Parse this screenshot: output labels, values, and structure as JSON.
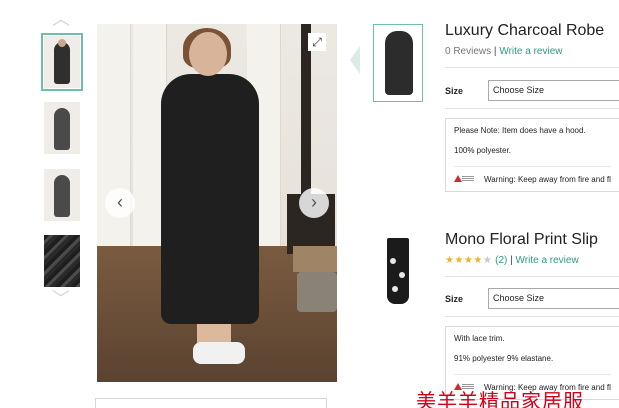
{
  "gallery": {
    "thumbnails": [
      {
        "kind": "model-full",
        "active": true
      },
      {
        "kind": "robe-front",
        "active": false
      },
      {
        "kind": "robe-back",
        "active": false
      },
      {
        "kind": "fabric-closeup",
        "active": false
      }
    ],
    "up_icon": "chevron-up-icon",
    "down_icon": "chevron-down-icon",
    "expand_icon": "expand-icon",
    "prev_icon": "chevron-left-icon",
    "next_icon": "chevron-right-icon",
    "up_glyph": "︿",
    "down_glyph": "﹀",
    "expand_glyph": "⤢",
    "prev_glyph": "‹",
    "next_glyph": "›"
  },
  "products": [
    {
      "title": "Luxury Charcoal Robe",
      "reviews_text": "0 Reviews",
      "separator": "|",
      "review_link": "Write a review",
      "size_label": "Size",
      "size_placeholder": "Choose Size",
      "note": "Please Note: Item does have a hood.",
      "composition": "100% polyester.",
      "warning": "Warning: Keep away from fire and fl"
    },
    {
      "title": "Mono Floral Print Slip",
      "rating": 4,
      "rating_max": 5,
      "stars_on": "★★★★",
      "stars_off": "★",
      "reviews_count": "(2)",
      "separator": "|",
      "review_link": "Write a review",
      "size_label": "Size",
      "size_placeholder": "Choose Size",
      "note": "With lace trim.",
      "composition": "91% polyester 9% elastane.",
      "warning": "Warning: Keep away from fire and fl"
    }
  ],
  "watermark": "美羊羊精品家居服",
  "colors": {
    "accent": "#2b9a86",
    "active_border": "#6dbfa9",
    "star": "#f0b323",
    "watermark": "#d0021b"
  }
}
